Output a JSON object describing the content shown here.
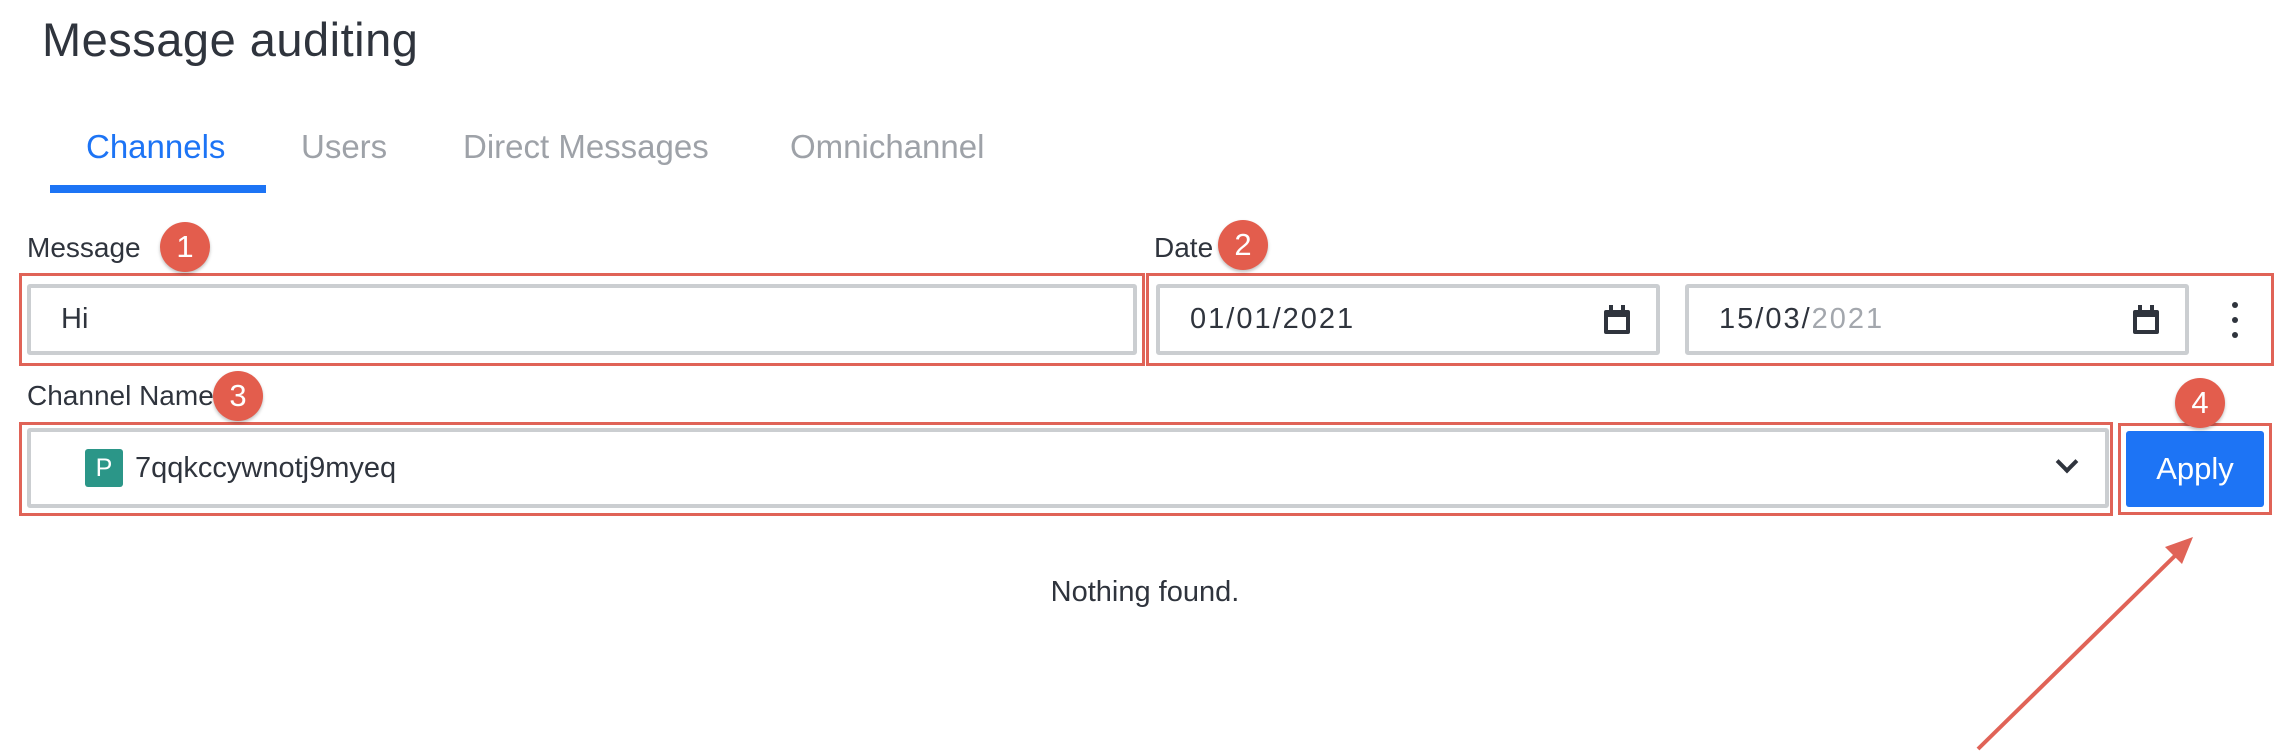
{
  "page": {
    "title": "Message auditing"
  },
  "tabs": [
    {
      "label": "Channels",
      "active": true
    },
    {
      "label": "Users",
      "active": false
    },
    {
      "label": "Direct Messages",
      "active": false
    },
    {
      "label": "Omnichannel",
      "active": false
    }
  ],
  "form": {
    "message": {
      "label": "Message",
      "value": "Hi"
    },
    "date": {
      "label": "Date",
      "start": {
        "day": "01",
        "month": "01",
        "year": "2021"
      },
      "end": {
        "day": "15",
        "month": "03",
        "year": "2021"
      }
    },
    "channel": {
      "label": "Channel Name",
      "avatar_letter": "P",
      "value": "7qqkccywnotj9myeq"
    },
    "apply_label": "Apply"
  },
  "results": {
    "empty_text": "Nothing found."
  },
  "annotations": {
    "badges": [
      "1",
      "2",
      "3",
      "4"
    ]
  },
  "colors": {
    "accent": "#1d74f5",
    "annotation": "#e35d4d",
    "avatar": "#2b9688"
  }
}
